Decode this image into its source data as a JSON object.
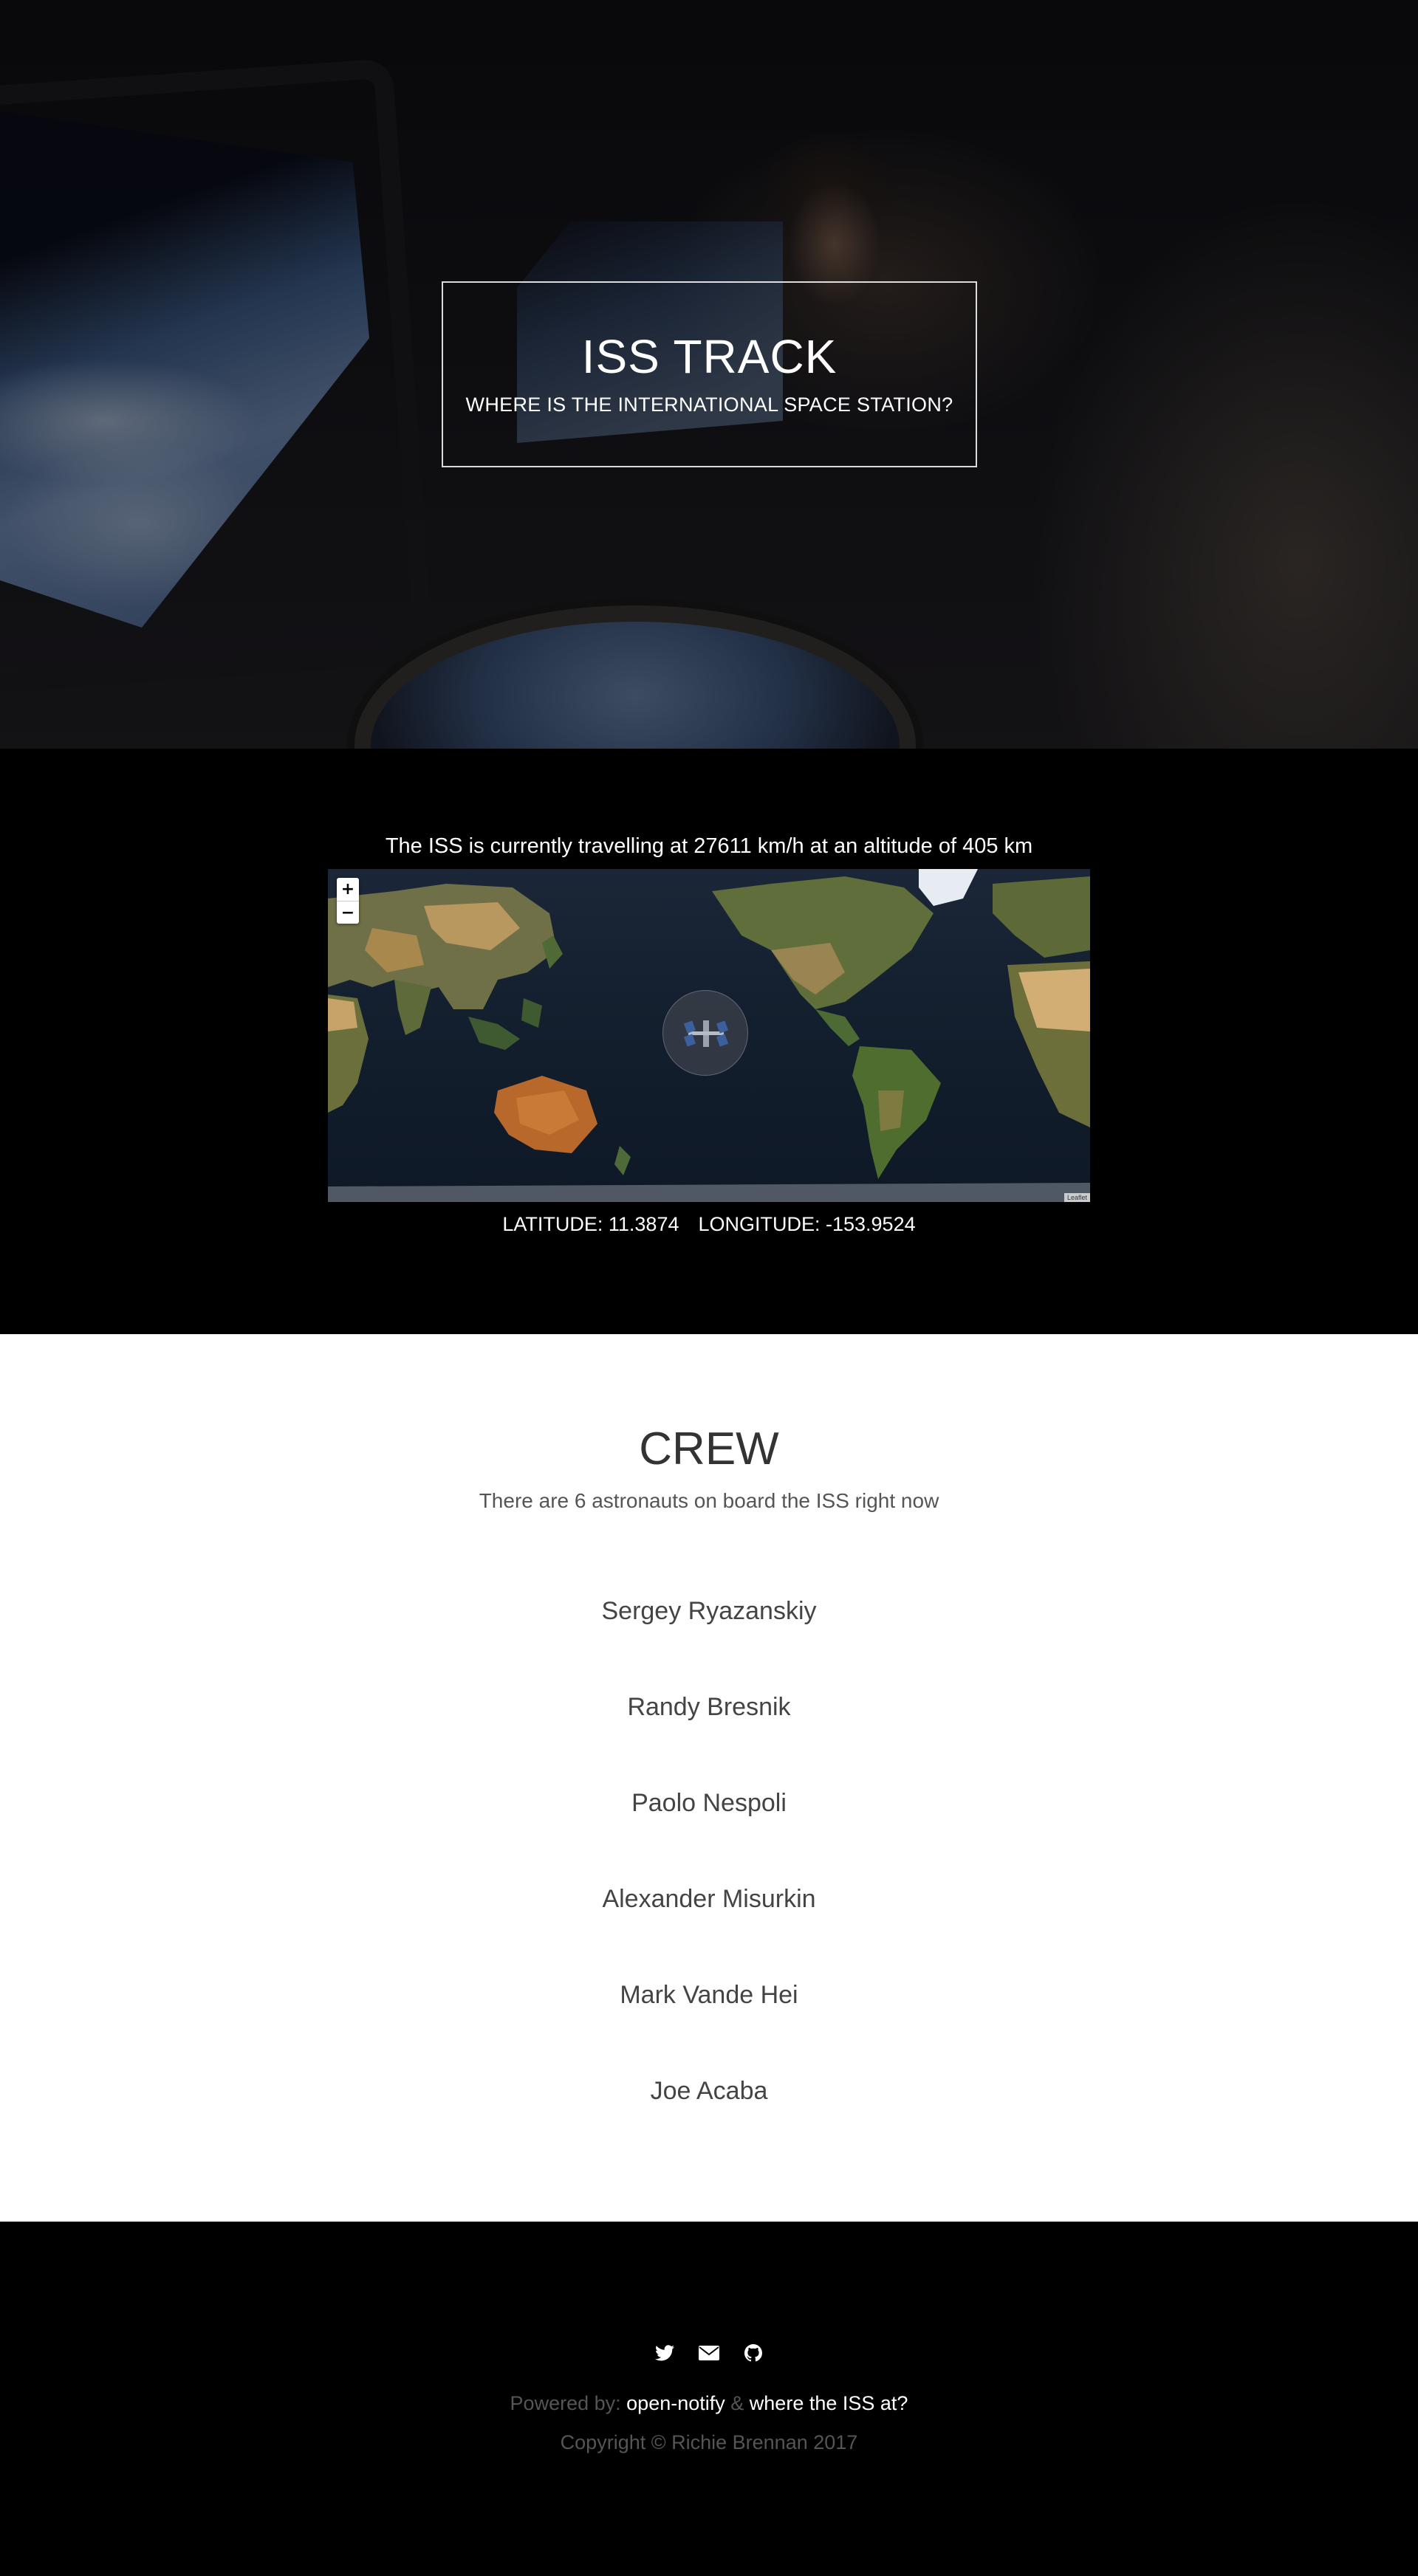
{
  "hero": {
    "title": "ISS TRACK",
    "subtitle": "WHERE IS THE INTERNATIONAL SPACE STATION?"
  },
  "tracker": {
    "speed_text": "The ISS is currently travelling at 27611 km/h at an altitude of 405 km",
    "map": {
      "zoom_in_label": "+",
      "zoom_out_label": "−",
      "attribution": "Leaflet",
      "marker_icon": "iss-icon"
    },
    "latitude_label": "LATITUDE: 11.3874",
    "longitude_label": "LONGITUDE: -153.9524"
  },
  "crew": {
    "title": "CREW",
    "subtitle": "There are 6 astronauts on board the ISS right now",
    "members": [
      "Sergey Ryazanskiy",
      "Randy Bresnik",
      "Paolo Nespoli",
      "Alexander Misurkin",
      "Mark Vande Hei",
      "Joe Acaba"
    ]
  },
  "footer": {
    "social_icons": [
      "twitter-icon",
      "envelope-icon",
      "github-icon"
    ],
    "powered_prefix": "Powered by:",
    "link_open_notify": "open-notify",
    "amp": "&",
    "link_where_iss": "where the ISS at?",
    "copyright": "Copyright © Richie Brennan 2017"
  },
  "colors": {
    "background": "#000000",
    "crew_background": "#ffffff",
    "text_light": "#ffffff",
    "text_muted": "#555555"
  }
}
